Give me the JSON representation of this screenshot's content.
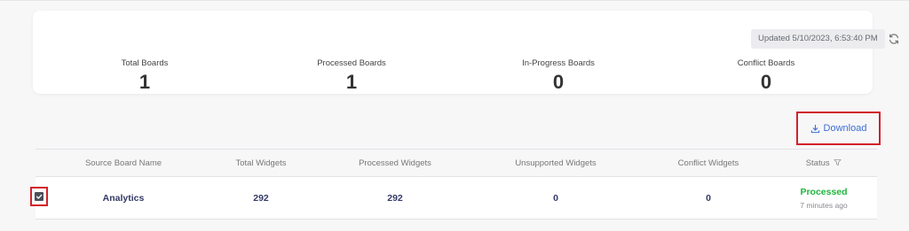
{
  "summary": {
    "updated_label": "Updated 5/10/2023, 6:53:40 PM",
    "stats": [
      {
        "label": "Total Boards",
        "value": "1"
      },
      {
        "label": "Processed Boards",
        "value": "1"
      },
      {
        "label": "In-Progress Boards",
        "value": "0"
      },
      {
        "label": "Conflict Boards",
        "value": "0"
      }
    ]
  },
  "toolbar": {
    "download_label": "Download"
  },
  "table": {
    "headers": [
      "Source Board Name",
      "Total Widgets",
      "Processed Widgets",
      "Unsupported Widgets",
      "Conflict Widgets",
      "Status"
    ],
    "rows": [
      {
        "name": "Analytics",
        "total": "292",
        "processed": "292",
        "unsupported": "0",
        "conflict": "0",
        "status": "Processed",
        "status_time": "7 minutes ago",
        "checked": true
      }
    ]
  },
  "colors": {
    "accent_blue": "#3c6ed6",
    "status_green": "#20b43c",
    "highlight_red": "#d2222a"
  },
  "icons": {
    "refresh": "refresh-icon",
    "download": "download-icon",
    "filter": "filter-icon",
    "check": "check-icon"
  }
}
